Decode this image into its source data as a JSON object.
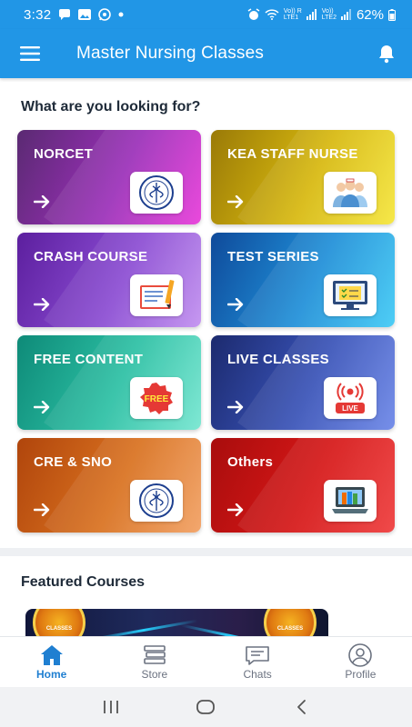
{
  "status_bar": {
    "time": "3:32",
    "network1": "Vo)) R\nLTE1",
    "network2": "Vo))\nLTE2",
    "battery": "62%",
    "icons": [
      "chat-bubble-icon",
      "gallery-icon",
      "whatsapp-icon",
      "dot-icon",
      "alarm-icon",
      "wifi-icon",
      "signal-icon",
      "battery-icon"
    ]
  },
  "app_bar": {
    "title": "Master Nursing Classes",
    "menu_icon": "hamburger-menu-icon",
    "bell_icon": "bell-icon",
    "color": "#2196e6"
  },
  "categories_heading": "What are you looking for?",
  "categories": [
    {
      "label": "NORCET",
      "icon": "aiims-emblem-icon"
    },
    {
      "label": "KEA STAFF NURSE",
      "icon": "nurses-group-icon"
    },
    {
      "label": "CRASH COURSE",
      "icon": "notebook-pencil-icon"
    },
    {
      "label": "TEST SERIES",
      "icon": "monitor-checklist-icon"
    },
    {
      "label": "FREE CONTENT",
      "icon": "free-badge-icon",
      "badge_text": "FREE"
    },
    {
      "label": "LIVE CLASSES",
      "icon": "live-broadcast-icon",
      "badge_text": "LIVE"
    },
    {
      "label": "CRE & SNO",
      "icon": "aiims-emblem-icon"
    },
    {
      "label": "Others",
      "icon": "books-laptop-icon"
    }
  ],
  "featured_heading": "Featured Courses",
  "featured_badge_text": "CLASSES",
  "bottom_nav": [
    {
      "label": "Home",
      "icon": "home-icon",
      "active": true
    },
    {
      "label": "Store",
      "icon": "books-stack-icon",
      "active": false
    },
    {
      "label": "Chats",
      "icon": "chat-icon",
      "active": false
    },
    {
      "label": "Profile",
      "icon": "user-icon",
      "active": false
    }
  ],
  "system_nav": [
    "recents-icon",
    "home-circle-icon",
    "back-icon"
  ]
}
